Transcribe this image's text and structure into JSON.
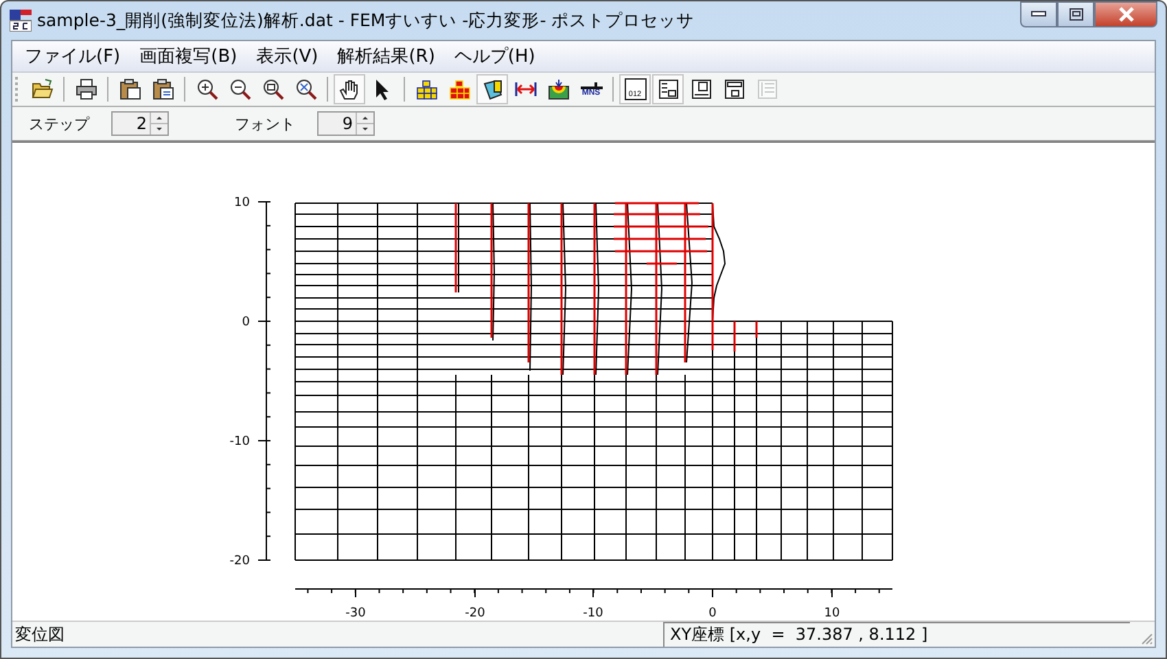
{
  "window": {
    "title": "sample-3_開削(強制変位法)解析.dat - FEMすいすい -応力変形- ポストプロセッサ"
  },
  "menu": [
    {
      "label": "ファイル(F)"
    },
    {
      "label": "画面複写(B)"
    },
    {
      "label": "表示(V)"
    },
    {
      "label": "解析結果(R)"
    },
    {
      "label": "ヘルプ(H)"
    }
  ],
  "toolbar": [
    {
      "kind": "open",
      "pressed": false,
      "disabled": false
    },
    {
      "kind": "sep"
    },
    {
      "kind": "print",
      "pressed": false,
      "disabled": false
    },
    {
      "kind": "sep"
    },
    {
      "kind": "copy",
      "pressed": false,
      "disabled": false
    },
    {
      "kind": "copy2",
      "pressed": false,
      "disabled": false
    },
    {
      "kind": "sep"
    },
    {
      "kind": "zoomin",
      "pressed": false,
      "disabled": false
    },
    {
      "kind": "zoomout",
      "pressed": false,
      "disabled": false
    },
    {
      "kind": "zoomfit",
      "pressed": false,
      "disabled": false
    },
    {
      "kind": "zoomall",
      "pressed": false,
      "disabled": false
    },
    {
      "kind": "sep"
    },
    {
      "kind": "hand",
      "pressed": true,
      "disabled": false
    },
    {
      "kind": "pointer",
      "pressed": false,
      "disabled": false
    },
    {
      "kind": "sep"
    },
    {
      "kind": "mesh",
      "pressed": false,
      "disabled": false
    },
    {
      "kind": "meshred",
      "pressed": false,
      "disabled": false
    },
    {
      "kind": "fill",
      "pressed": true,
      "disabled": false
    },
    {
      "kind": "dimension",
      "pressed": false,
      "disabled": false
    },
    {
      "kind": "contour",
      "pressed": false,
      "disabled": false
    },
    {
      "kind": "mns",
      "label": "MNS",
      "pressed": false,
      "disabled": false
    },
    {
      "kind": "sep"
    },
    {
      "kind": "layout1",
      "label": "012",
      "pressed": true,
      "disabled": false
    },
    {
      "kind": "layout2",
      "pressed": true,
      "disabled": false
    },
    {
      "kind": "layout3",
      "pressed": false,
      "disabled": false
    },
    {
      "kind": "layout4",
      "pressed": false,
      "disabled": false
    },
    {
      "kind": "layout5",
      "pressed": false,
      "disabled": true
    }
  ],
  "options": [
    {
      "label": "ステップ",
      "value": "2"
    },
    {
      "label": "フォント",
      "value": "9"
    }
  ],
  "plot": {
    "y_ticks": [
      "10",
      "0",
      "-10",
      "-20"
    ],
    "x_ticks": [
      "-30",
      "-20",
      "-10",
      "0",
      "10"
    ]
  },
  "status_bar": {
    "left": "変位図",
    "right": "XY座標 [x,y  =  37.387 , 8.112 ]"
  }
}
